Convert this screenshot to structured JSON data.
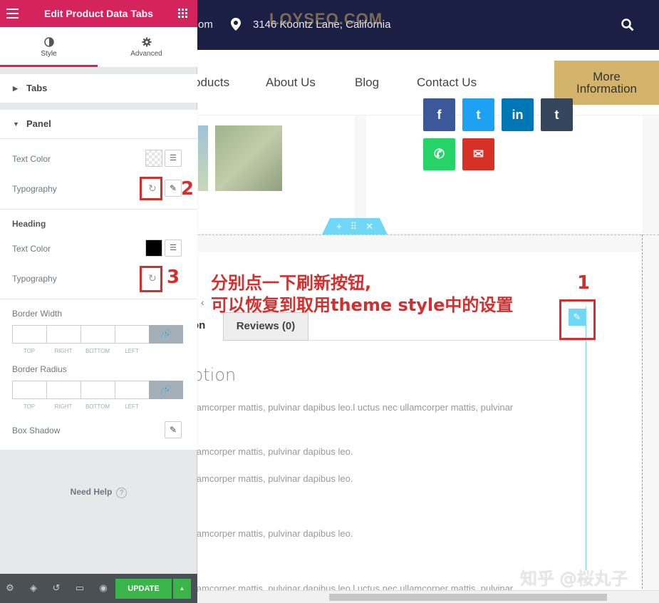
{
  "site": {
    "email_fragment": "om",
    "address": "3146 Koontz Lane, California",
    "watermark": "LOYSEO.COM",
    "nav": [
      "oducts",
      "About Us",
      "Blog",
      "Contact Us"
    ],
    "more_button": [
      "More",
      "Information"
    ],
    "tabs": {
      "description_fragment": "on",
      "reviews": "Reviews (0)"
    },
    "description_title": "ption",
    "paragraphs": [
      "llamcorper mattis, pulvinar dapibus leo.l uctus nec ullamcorper mattis, pulvinar",
      "llamcorper mattis, pulvinar dapibus leo.",
      "llamcorper mattis, pulvinar dapibus leo.",
      "llamcorper mattis, pulvinar dapibus leo.",
      "llamcorper mattis, pulvinar dapibus leo.l uctus nec ullamcorper mattis, pulvinar"
    ],
    "social_colors": [
      "#3b5998",
      "#1da1f2",
      "#0077b5",
      "#35465c",
      "#25d366",
      "#d93025"
    ]
  },
  "annotation": {
    "line1": "分别点一下刷新按钮,",
    "line2": "可以恢复到取用theme style中的设置",
    "markers": [
      "1",
      "2",
      "3"
    ]
  },
  "zhihu_watermark": "知乎 @桜丸子",
  "panel": {
    "title": "Edit Product Data Tabs",
    "tabs": [
      {
        "label": "Style",
        "icon": "half-circle-icon"
      },
      {
        "label": "Advanced",
        "icon": "gear-icon"
      }
    ],
    "sections": {
      "tabs": "Tabs",
      "panel": "Panel"
    },
    "text_color": "Text Color",
    "typography": "Typography",
    "heading": "Heading",
    "heading_text_color": "Text Color",
    "heading_typography": "Typography",
    "border_width": "Border Width",
    "border_radius": "Border Radius",
    "dim_labels": [
      "TOP",
      "RIGHT",
      "BOTTOM",
      "LEFT"
    ],
    "box_shadow": "Box Shadow",
    "need_help": "Need Help",
    "update": "UPDATE",
    "accent": "#d5235d",
    "update_color": "#39b54a"
  }
}
